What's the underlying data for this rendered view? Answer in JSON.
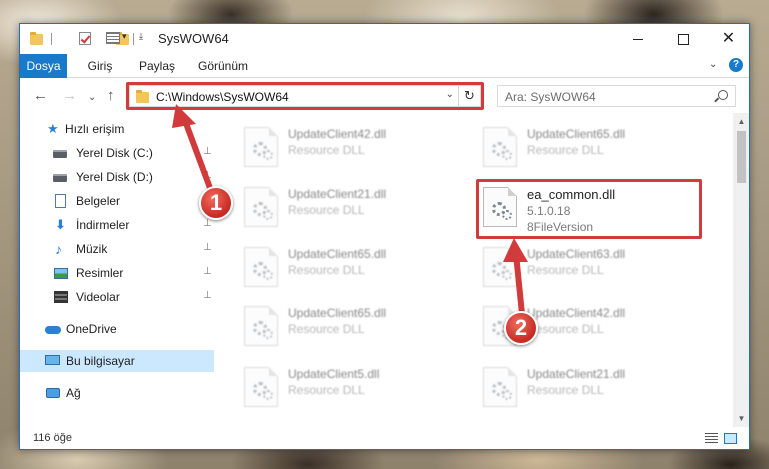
{
  "window": {
    "title": "SysWOW64",
    "controls": {
      "minimize": "minimize",
      "maximize": "maximize",
      "close": "✕"
    }
  },
  "ribbon": {
    "tabs": [
      "Dosya",
      "Giriş",
      "Paylaş",
      "Görünüm"
    ],
    "collapse_glyph": "⌄",
    "help_glyph": "?"
  },
  "address": {
    "path": "C:\\Windows\\SysWOW64",
    "dropdown_glyph": "⌄",
    "refresh_glyph": "↻"
  },
  "search": {
    "placeholder": "Ara: SysWOW64"
  },
  "navigation": {
    "back_glyph": "←",
    "forward_glyph": "→",
    "recent_glyph": "⌄",
    "up_glyph": "↑"
  },
  "sidebar": {
    "items": [
      {
        "label": "Hızlı erişim",
        "icon": "star-icon",
        "pinned": false
      },
      {
        "label": "Yerel Disk (C:)",
        "icon": "disk-icon",
        "pinned": true
      },
      {
        "label": "Yerel Disk (D:)",
        "icon": "disk-icon",
        "pinned": true
      },
      {
        "label": "Belgeler",
        "icon": "document-icon",
        "pinned": true
      },
      {
        "label": "İndirmeler",
        "icon": "download-icon",
        "pinned": true
      },
      {
        "label": "Müzik",
        "icon": "music-icon",
        "pinned": true
      },
      {
        "label": "Resimler",
        "icon": "pictures-icon",
        "pinned": true
      },
      {
        "label": "Videolar",
        "icon": "videos-icon",
        "pinned": true
      },
      {
        "label": "OneDrive",
        "icon": "cloud-icon",
        "pinned": false
      },
      {
        "label": "Bu bilgisayar",
        "icon": "computer-icon",
        "pinned": false,
        "selected": true
      },
      {
        "label": "Ağ",
        "icon": "network-icon",
        "pinned": false
      }
    ],
    "pin_glyph": "📌"
  },
  "files": {
    "left_column": [
      {
        "name": "UpdateClient42.dll",
        "type": "Resource DLL"
      },
      {
        "name": "UpdateClient21.dll",
        "type": "Resource DLL"
      },
      {
        "name": "UpdateClient65.dll",
        "type": "Resource DLL"
      },
      {
        "name": "UpdateClient65.dll",
        "type": "Resource DLL"
      },
      {
        "name": "UpdateClient5.dll",
        "type": "Resource DLL"
      }
    ],
    "right_column": [
      {
        "name": "UpdateClient65.dll",
        "type": "Resource DLL"
      },
      {
        "name": "UpdateClient63.dll",
        "type": "Resource DLL"
      },
      {
        "name": "UpdateClient42.dll",
        "type": "Resource DLL"
      },
      {
        "name": "UpdateClient21.dll",
        "type": "Resource DLL"
      }
    ],
    "highlighted": {
      "name": "ea_common.dll",
      "version": "5.1.0.18",
      "description": "8FileVersion"
    }
  },
  "scrollbar": {
    "up_glyph": "▲",
    "down_glyph": "▼"
  },
  "status": {
    "count": "116 öğe"
  },
  "callouts": {
    "first": "1",
    "second": "2"
  },
  "colors": {
    "accent": "#1979ca",
    "highlight": "#d13b3b",
    "selected": "#cce8ff"
  }
}
